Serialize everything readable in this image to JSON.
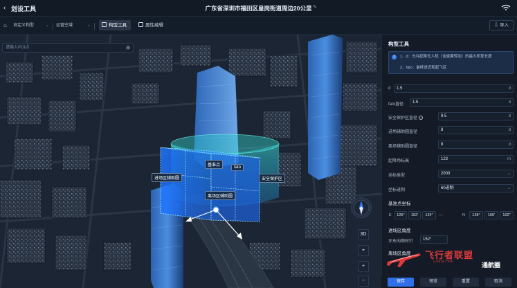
{
  "header": {
    "app_title": "划设工具",
    "page_title": "广东省深圳市福田区皇岗街道周边20公里"
  },
  "toolbar": {
    "model_select": "自定义构型",
    "scenario_select": "运营空域",
    "tab_shape_tool": "构型工具",
    "tab_property_edit": "属性编辑",
    "import_label": "导入"
  },
  "map": {
    "search_placeholder": "请输入POI点",
    "labels": {
      "approach_aux_circle": "进场区辅助圆",
      "base_point": "基准点",
      "fato": "fato",
      "safety_zone": "安全保护区",
      "departure_aux_circle": "离场区辅助圆"
    },
    "btn_3d": "3D",
    "btn_locate": "⌖",
    "btn_zoom_in": "+",
    "btn_zoom_out": "−"
  },
  "panel": {
    "title": "构型工具",
    "tips": [
      "1、d：允许起降无人机（含旋翼转动）的最大机型长度",
      "2、fato：最终进近和起飞区"
    ],
    "fields": [
      {
        "label": "d",
        "value": "1.5",
        "unit": "d"
      },
      {
        "label": "fato直径",
        "value": "1.5",
        "unit": "d"
      },
      {
        "label": "安全保护区直径",
        "value": "9.5",
        "unit": "d"
      },
      {
        "label": "进场辅助圆直径",
        "value": "8",
        "unit": "d"
      },
      {
        "label": "离场辅助圆直径",
        "value": "8",
        "unit": "d"
      },
      {
        "label": "起降场标高",
        "value": "123",
        "unit": "m"
      },
      {
        "label": "坐标类型",
        "value": "2000",
        "unit": ""
      },
      {
        "label": "坐标进制",
        "value": "60进制",
        "unit": ""
      }
    ],
    "base_coord_title": "基准点坐标",
    "coord": {
      "e_label": "E",
      "e_deg": "126°",
      "e_min": "102'",
      "e_sec": "124\"",
      "sep": "—",
      "n_label": "N",
      "n_deg": "128°",
      "n_min": "100'",
      "n_sec": "102\""
    },
    "approach_angle_title": "进场区角度",
    "approach_angle_label": "正东向顺时针",
    "approach_angle_value": "152°",
    "departure_angle_title": "离场区角度"
  },
  "footer": {
    "save": "保存",
    "preview": "预览",
    "reset": "重置",
    "cancel": "取消"
  },
  "watermark": {
    "text1": "飞行者联盟",
    "text2": "China Flier",
    "text3": "通航圈"
  },
  "colors": {
    "accent": "#2f6fe8",
    "zone_blue": "#1d7bff",
    "zone_cyan": "#35d6d0",
    "watermark_red": "#e03a3a"
  }
}
